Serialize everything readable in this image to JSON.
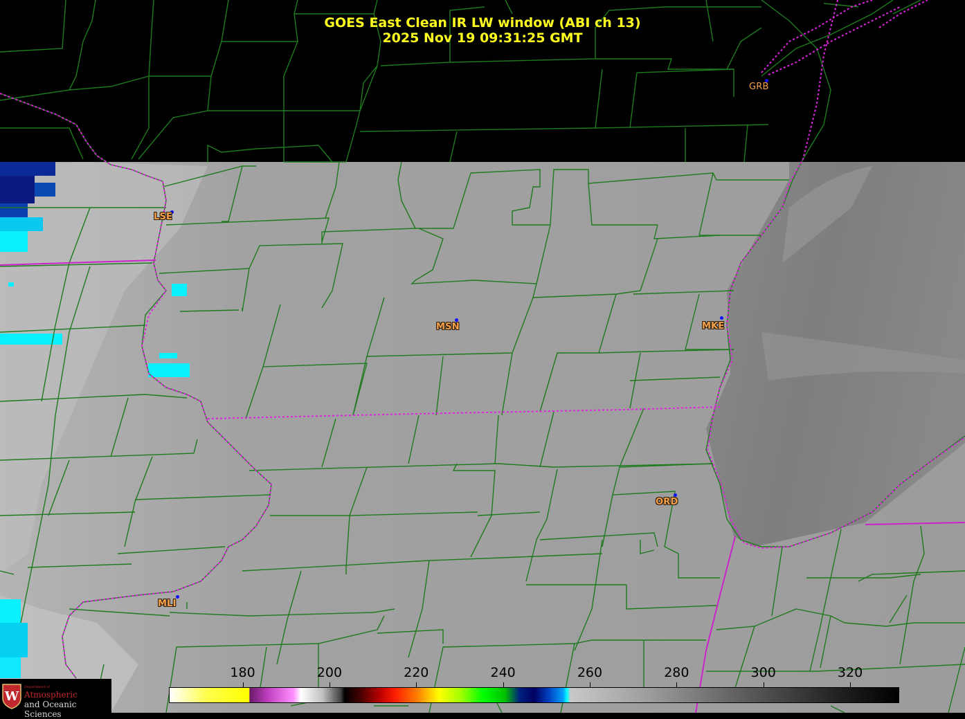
{
  "title": {
    "line1": "GOES East Clean IR LW window (ABI ch 13)",
    "line2": "2025 Nov 19  09:31:25 GMT"
  },
  "stations": [
    {
      "code": "GRB"
    },
    {
      "code": "LSE"
    },
    {
      "code": "MSN"
    },
    {
      "code": "MKE"
    },
    {
      "code": "ORD"
    },
    {
      "code": "MLI"
    }
  ],
  "colorbar": {
    "ticks": [
      "180",
      "200",
      "220",
      "240",
      "260",
      "280",
      "300",
      "320"
    ],
    "range": [
      163,
      331
    ]
  },
  "logo": {
    "dept": "Department of",
    "line1": "Atmospheric",
    "line2": "and Oceanic Sciences",
    "seal_letter": "W"
  },
  "colors": {
    "title": "#ffff1e",
    "county_lines": "#1e7a1e",
    "state_lines": "#e022e0",
    "station_label": "#f5a04a",
    "station_dot": "#1010ff"
  }
}
